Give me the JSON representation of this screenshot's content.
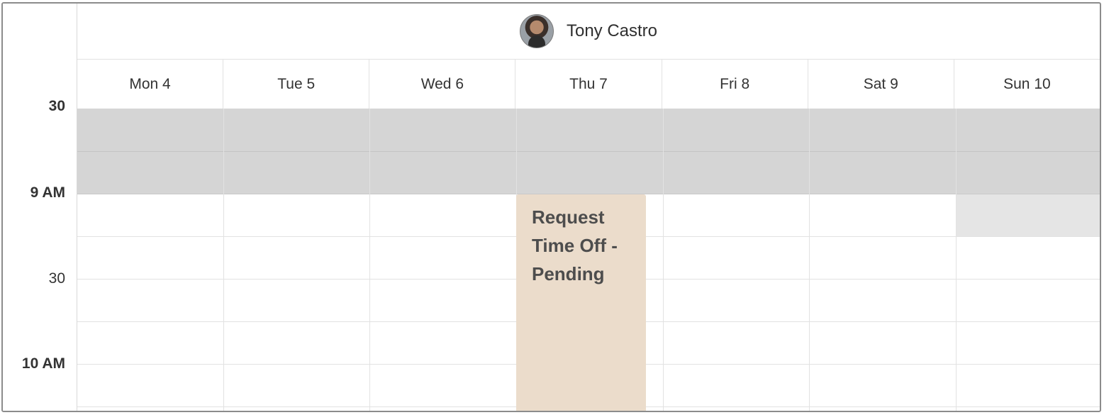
{
  "user": {
    "name": "Tony Castro",
    "avatar_icon": "user-avatar"
  },
  "days": [
    {
      "label": "Mon 4"
    },
    {
      "label": "Tue 5"
    },
    {
      "label": "Wed 6"
    },
    {
      "label": "Thu 7"
    },
    {
      "label": "Fri 8"
    },
    {
      "label": "Sat 9"
    },
    {
      "label": "Sun 10"
    }
  ],
  "time_labels": {
    "t830": "30",
    "t900": "9 AM",
    "t930": "30",
    "t1000": "10 AM"
  },
  "event": {
    "title": "Request Time Off - Pending",
    "day": "Thu 7",
    "color": "#ebdccb"
  },
  "colors": {
    "unavailable_shade": "#d5d5d5",
    "grid_line": "#e2e2e2",
    "text": "#333333"
  }
}
